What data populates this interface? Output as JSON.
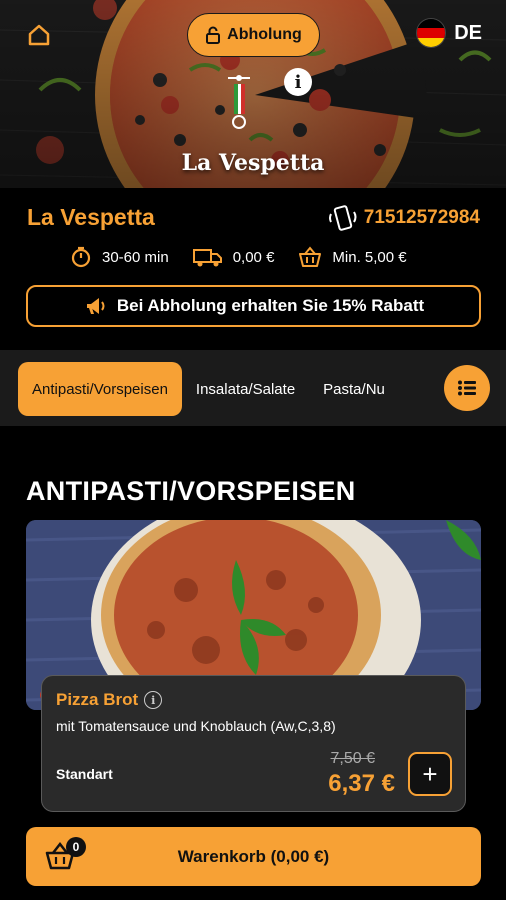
{
  "header": {
    "pickup_label": "Abholung",
    "language": "DE",
    "logo_text": "La Vespetta"
  },
  "restaurant": {
    "name": "La Vespetta",
    "phone": "71512572984",
    "delivery_time": "30-60 min",
    "delivery_fee": "0,00 €",
    "minimum_order": "Min. 5,00 €",
    "promo": "Bei Abholung erhalten Sie 15% Rabatt"
  },
  "categories": [
    {
      "label": "Antipasti/Vorspeisen",
      "active": true
    },
    {
      "label": "Insalata/Salate",
      "active": false
    },
    {
      "label": "Pasta/Nu",
      "active": false
    }
  ],
  "section": {
    "title": "ANTIPASTI/VORSPEISEN"
  },
  "product": {
    "name": "Pizza Brot",
    "description": "mit Tomatensauce und Knoblauch (Aw,C,3,8)",
    "variant": "Standart",
    "old_price": "7,50 €",
    "price": "6,37 €",
    "add_symbol": "+"
  },
  "cart": {
    "label": "Warenkorb (0,00 €)",
    "count": "0"
  },
  "colors": {
    "accent": "#f7a135",
    "background": "#000000",
    "card": "#2a2a2a"
  },
  "icons": [
    "home-icon",
    "lock-icon",
    "flag-de-icon",
    "info-icon",
    "vespa-logo-icon",
    "phone-icon",
    "timer-icon",
    "delivery-truck-icon",
    "basket-icon",
    "megaphone-icon",
    "list-menu-icon",
    "plus-icon",
    "cart-icon"
  ]
}
